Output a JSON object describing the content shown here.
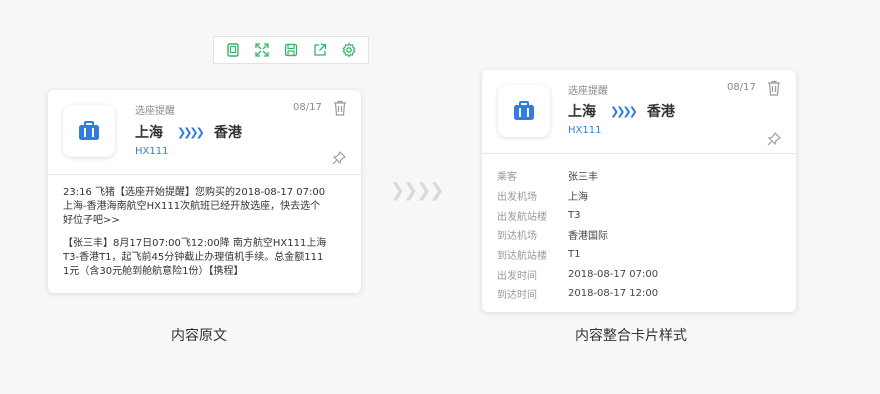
{
  "toolbar": {
    "buttons": [
      {
        "name": "copy-icon"
      },
      {
        "name": "fullscreen-icon"
      },
      {
        "name": "save-icon"
      },
      {
        "name": "share-icon"
      },
      {
        "name": "settings-icon"
      }
    ],
    "accent": "#33b36b"
  },
  "left_card": {
    "category": "选座提醒",
    "date": "08/17",
    "from": "上海",
    "to": "香港",
    "flight": "HX111",
    "message_1": [
      "23:16  飞猪【选座开始提醒】您购买的2018-08-17 07:00",
      "上海-香港海南航空HX111次航班已经开放选座，快去选个",
      "好位子吧>>"
    ],
    "message_2": [
      "【张三丰】8月17日07:00飞12:00降 南方航空HX111上海",
      "T3-香港T1，起飞前45分钟截止办理值机手续。总金额111",
      "1元（含30元舱到舱航意险1份）【携程】"
    ]
  },
  "right_card": {
    "category": "选座提醒",
    "date": "08/17",
    "from": "上海",
    "to": "香港",
    "flight": "HX111",
    "details": [
      {
        "key": "乘客",
        "value": "张三丰"
      },
      {
        "key": "出发机场",
        "value": "上海"
      },
      {
        "key": "出发航站楼",
        "value": "T3"
      },
      {
        "key": "到达机场",
        "value": "香港国际"
      },
      {
        "key": "到达航站楼",
        "value": "T1"
      },
      {
        "key": "出发时间",
        "value": "2018-08-17 07:00"
      },
      {
        "key": "到达时间",
        "value": "2018-08-17 12:00"
      }
    ]
  },
  "route_arrows": "❯❯❯❯",
  "captions": {
    "left": "内容原文",
    "right": "内容整合卡片样式"
  },
  "colors": {
    "brand_blue": "#2f7de1",
    "toolbar_green": "#33b36b"
  }
}
